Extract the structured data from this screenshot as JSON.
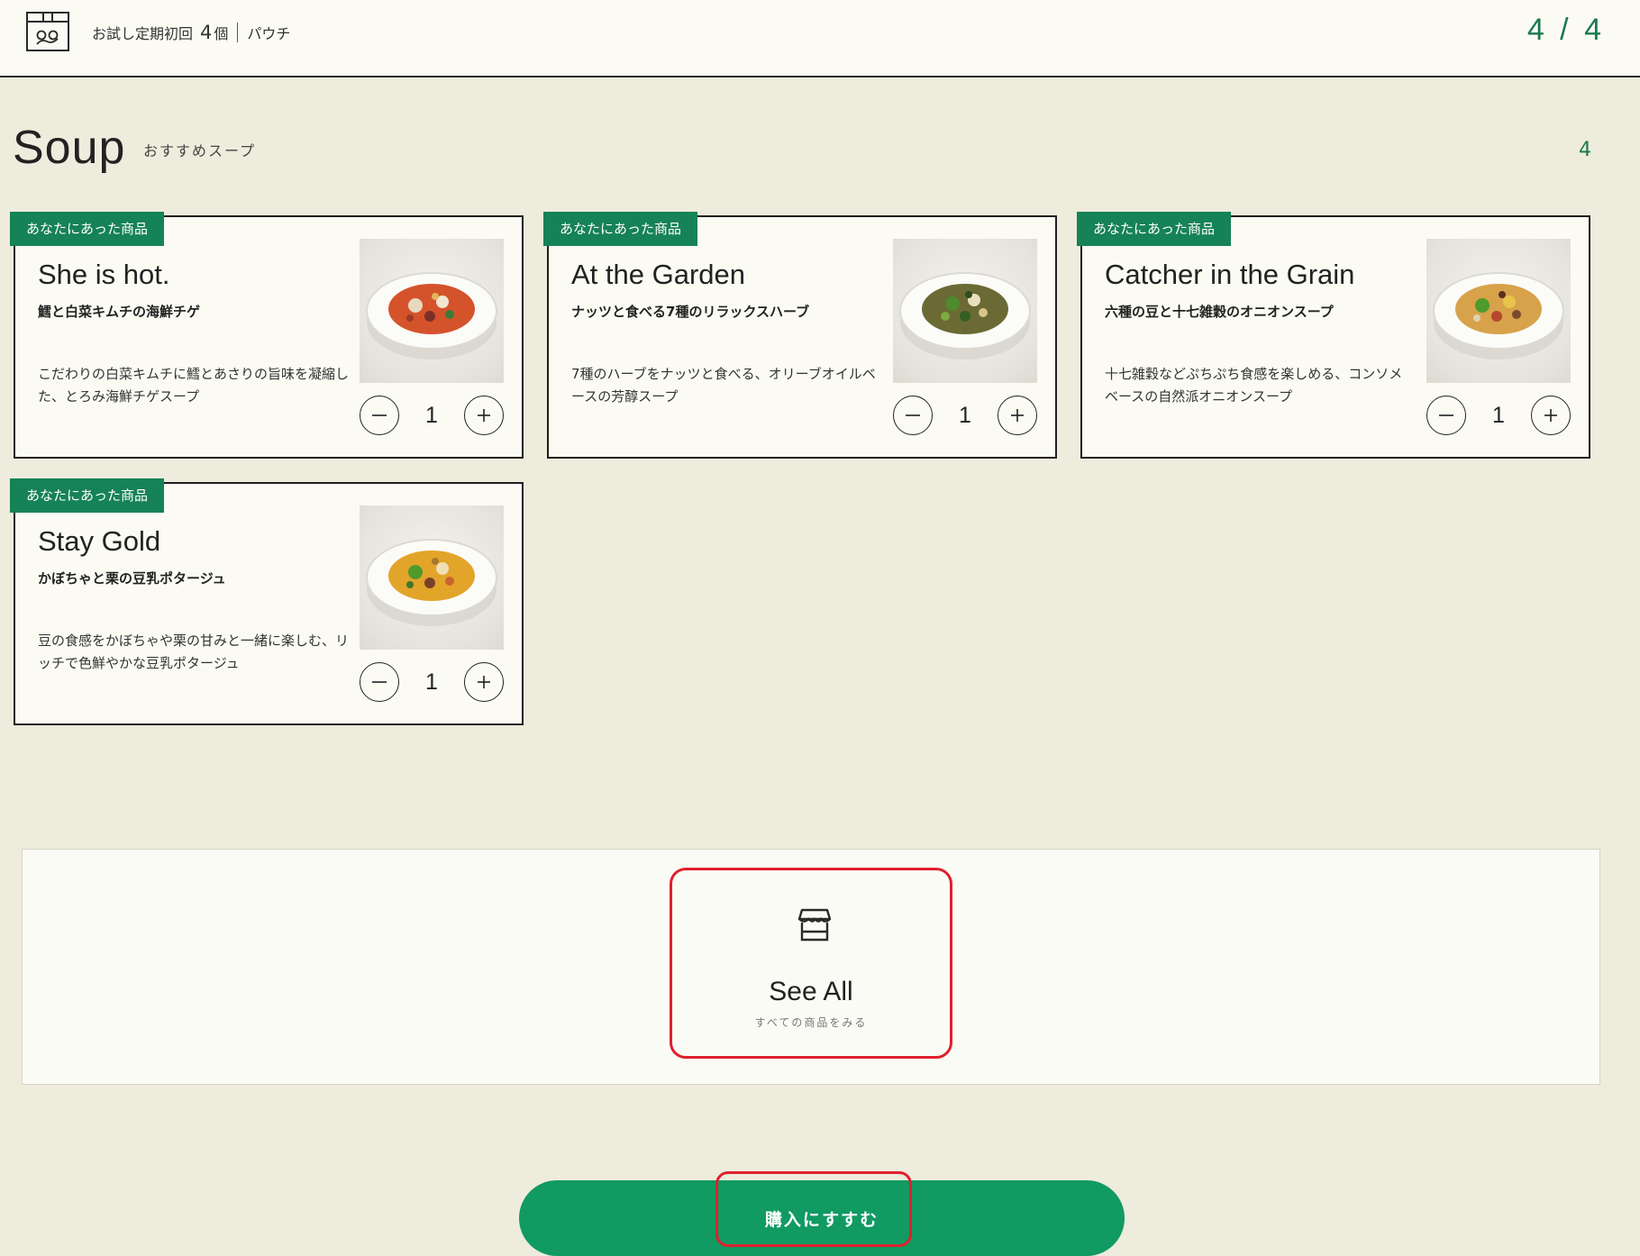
{
  "header": {
    "plan_label": "お試し定期初回",
    "count": "4",
    "count_unit": "個",
    "package": "パウチ",
    "progress": "4 / 4"
  },
  "section": {
    "title": "Soup",
    "subtitle": "おすすめスープ",
    "count": "4"
  },
  "products": [
    {
      "badge": "あなたにあった商品",
      "name": "She is hot.",
      "subtitle": "鱈と白菜キムチの海鮮チゲ",
      "description": "こだわりの白菜キムチに鱈とあさりの旨味を凝縮した、とろみ海鮮チゲスープ",
      "quantity": "1"
    },
    {
      "badge": "あなたにあった商品",
      "name": "At the Garden",
      "subtitle": "ナッツと食べる7種のリラックスハーブ",
      "description": "7種のハーブをナッツと食べる、オリーブオイルベースの芳醇スープ",
      "quantity": "1"
    },
    {
      "badge": "あなたにあった商品",
      "name": "Catcher in the Grain",
      "subtitle": "六種の豆と十七雑穀のオニオンスープ",
      "description": "十七雑穀などぷちぷち食感を楽しめる、コンソメベースの自然派オニオンスープ",
      "quantity": "1"
    },
    {
      "badge": "あなたにあった商品",
      "name": "Stay Gold",
      "subtitle": "かぼちゃと栗の豆乳ポタージュ",
      "description": "豆の食感をかぼちゃや栗の甘みと一緒に楽しむ、リッチで色鮮やかな豆乳ポタージュ",
      "quantity": "1"
    }
  ],
  "see_all": {
    "label": "See All",
    "sublabel": "すべての商品をみる",
    "icon": "shop-icon"
  },
  "purchase": {
    "label": "購入にすすむ"
  },
  "colors": {
    "accent": "#168257",
    "button": "#119a62",
    "highlight": "#e0202e",
    "background": "#eeecdc"
  }
}
